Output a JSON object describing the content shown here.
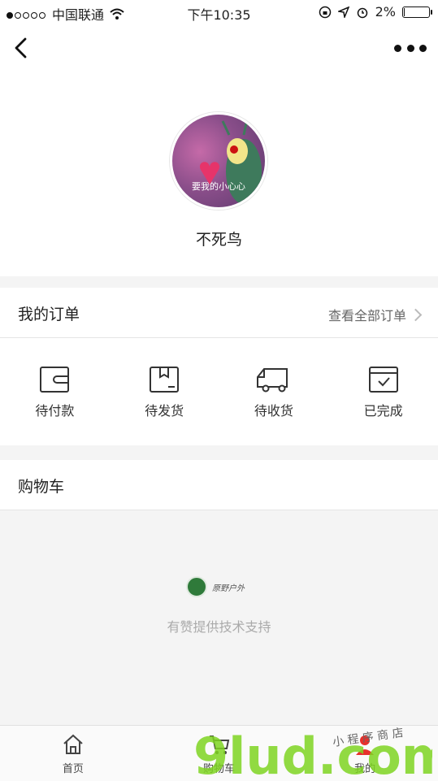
{
  "status_bar": {
    "carrier": "中国联通",
    "time": "下午10:35",
    "battery": "2%",
    "battery_level": 0.02
  },
  "nav": {
    "back_icon": "chevron-left-icon",
    "more_icon": "more-dots-icon"
  },
  "profile": {
    "avatar_caption": "要我的小心心",
    "username": "不死鸟"
  },
  "orders": {
    "title": "我的订单",
    "view_all": "查看全部订单",
    "items": [
      {
        "label": "待付款",
        "icon": "wallet-icon"
      },
      {
        "label": "待发货",
        "icon": "package-icon"
      },
      {
        "label": "待收货",
        "icon": "truck-icon"
      },
      {
        "label": "已完成",
        "icon": "check-box-icon"
      }
    ]
  },
  "cart": {
    "title": "购物车"
  },
  "footer": {
    "logo_text": "原野户外",
    "support": "有赞提供技术支持"
  },
  "tabbar": {
    "tabs": [
      {
        "label": "首页",
        "icon": "home-icon"
      },
      {
        "label": "购物车",
        "icon": "cart-icon"
      },
      {
        "label": "我的",
        "icon": "user-icon"
      }
    ]
  },
  "watermark": {
    "main": "9lud.com",
    "sub": "小 程 序 商 店"
  }
}
